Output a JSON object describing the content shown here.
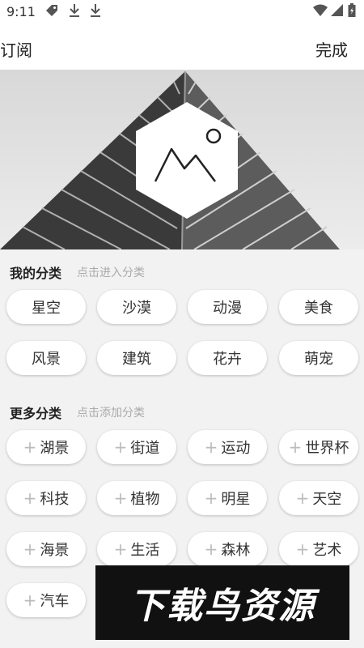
{
  "status_bar": {
    "time": "9:11"
  },
  "header": {
    "title": "订阅",
    "done_label": "完成"
  },
  "my_categories": {
    "title": "我的分类",
    "hint": "点击进入分类",
    "items": [
      "星空",
      "沙漠",
      "动漫",
      "美食",
      "风景",
      "建筑",
      "花卉",
      "萌宠"
    ]
  },
  "more_categories": {
    "title": "更多分类",
    "hint": "点击添加分类",
    "add_symbol": "+",
    "items": [
      "湖景",
      "街道",
      "运动",
      "世界杯",
      "科技",
      "植物",
      "明星",
      "天空",
      "海景",
      "生活",
      "森林",
      "艺术",
      "汽车"
    ]
  },
  "watermark": {
    "text": "下载鸟资源"
  }
}
